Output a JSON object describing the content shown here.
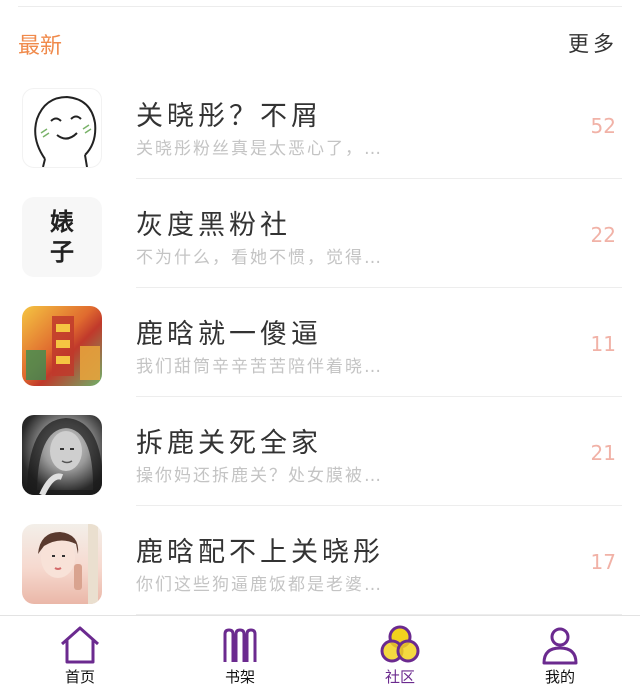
{
  "section": {
    "title": "最新",
    "more_label": "更多"
  },
  "posts": [
    {
      "title": "关晓彤？不屑",
      "preview": "关晓彤粉丝真是太恶心了，…",
      "count": "52",
      "avatar": "smiley-face-sticker"
    },
    {
      "title": "灰度黑粉社",
      "preview": "不为什么，看她不惯，觉得…",
      "count": "22",
      "avatar_text": [
        "婊",
        "子"
      ]
    },
    {
      "title": "鹿晗就一傻逼",
      "preview": "我们甜筒辛辛苦苦陪伴着晓…",
      "count": "11",
      "avatar": "colorful-temple-photo"
    },
    {
      "title": "拆鹿关死全家",
      "preview": "操你妈还拆鹿关？处女膜被…",
      "count": "21",
      "avatar": "black-white-portrait"
    },
    {
      "title": "鹿晗配不上关晓彤",
      "preview": "你们这些狗逼鹿饭都是老婆…",
      "count": "17",
      "avatar": "girl-portrait"
    }
  ],
  "nav": {
    "items": [
      {
        "label": "首页",
        "icon": "home-icon"
      },
      {
        "label": "书架",
        "icon": "bookshelf-icon"
      },
      {
        "label": "社区",
        "icon": "community-icon",
        "active": true
      },
      {
        "label": "我的",
        "icon": "profile-icon"
      }
    ]
  },
  "colors": {
    "accent_orange": "#f08a4b",
    "count_pink": "#f1b2a7",
    "nav_purple": "#6b2a8f",
    "community_yellow": "#f2d21e"
  }
}
